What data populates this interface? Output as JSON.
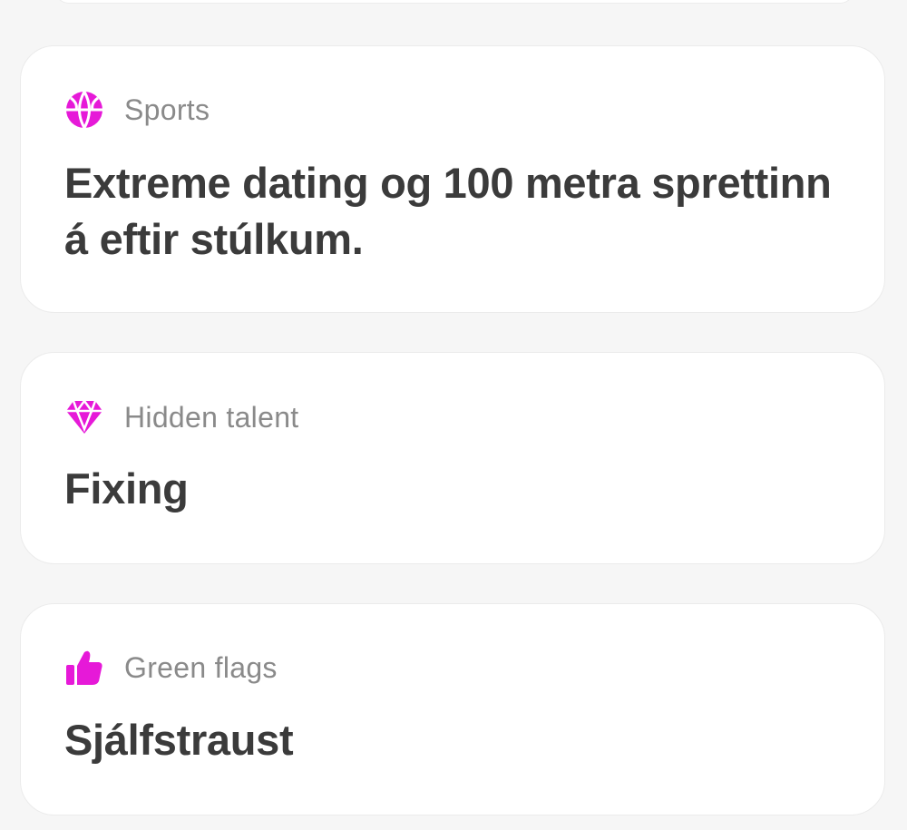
{
  "colors": {
    "accent": "#e619d8",
    "label": "#8a8a8a",
    "value": "#3b3b3b",
    "card_bg": "#ffffff",
    "page_bg": "#f6f6f6"
  },
  "cards": [
    {
      "icon": "basketball-icon",
      "label": "Sports",
      "value": "Extreme dating og 100 metra sprettinn á eftir stúlkum."
    },
    {
      "icon": "gem-icon",
      "label": "Hidden talent",
      "value": "Fixing"
    },
    {
      "icon": "thumbs-up-icon",
      "label": "Green flags",
      "value": "Sjálfstraust"
    }
  ]
}
